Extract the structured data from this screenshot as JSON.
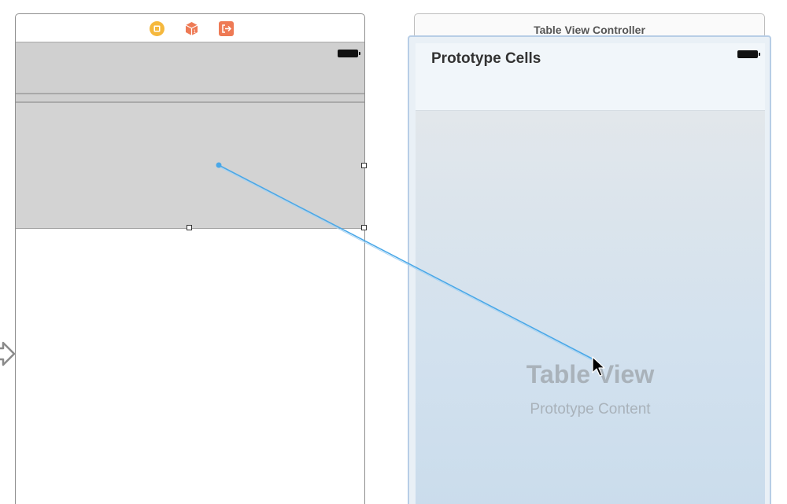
{
  "left_scene": {
    "dock_icons": [
      "view-controller-icon",
      "first-responder-icon",
      "exit-icon"
    ]
  },
  "right_scene": {
    "title": "Table View Controller",
    "prototype_cells_label": "Prototype Cells",
    "table_view_label": "Table View",
    "prototype_content_label": "Prototype Content"
  },
  "colors": {
    "connection_line": "#4aa8e8",
    "scene_selection_border": "#b7cde6",
    "view_controller_icon": "#f5b83d",
    "first_responder_icon": "#ee7a55",
    "exit_icon": "#ee7a55"
  }
}
